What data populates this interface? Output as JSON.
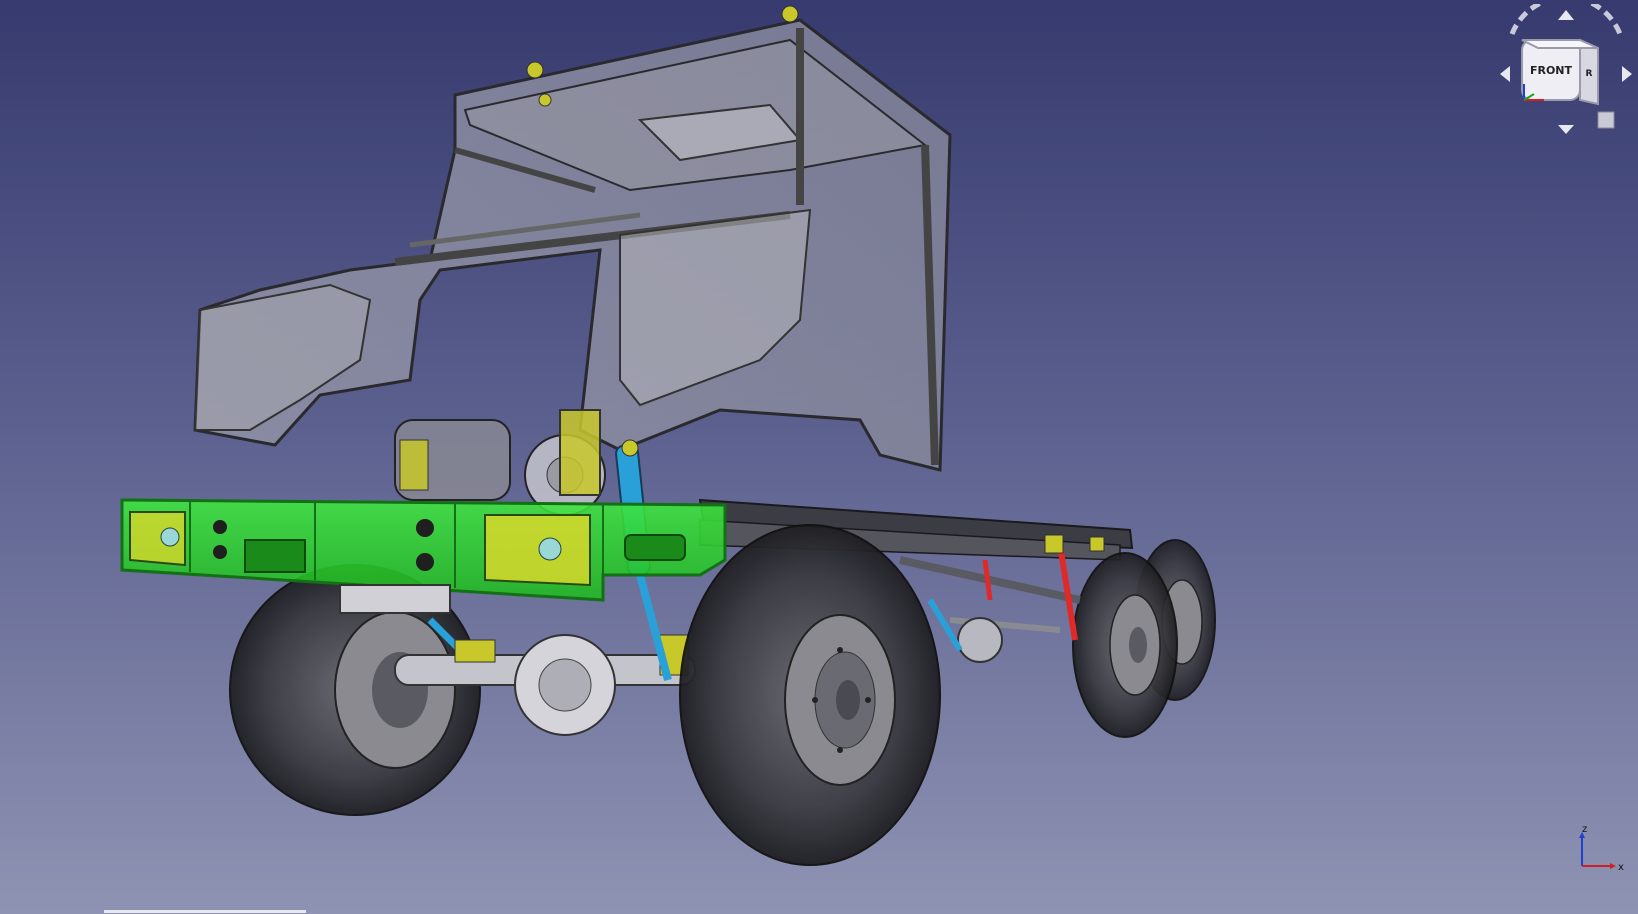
{
  "viewport": {
    "background_top": "#363a6e",
    "background_bottom": "#8f93b3"
  },
  "navigation_cube": {
    "front_label": "FRONT",
    "right_label": "R",
    "accent": "#e8e8f0"
  },
  "axis_indicator": {
    "x_label": "x",
    "z_label": "z",
    "x_color": "#d02020",
    "z_color": "#2040d0"
  },
  "model": {
    "selected_color": "#2fd82f",
    "cab_frame_color": "#8a8a8a",
    "tire_color": "#2f2f2f",
    "shock_colors": {
      "front": "#2aa0d8",
      "rear": "#e02a2a",
      "mount": "#c8c82a"
    }
  }
}
